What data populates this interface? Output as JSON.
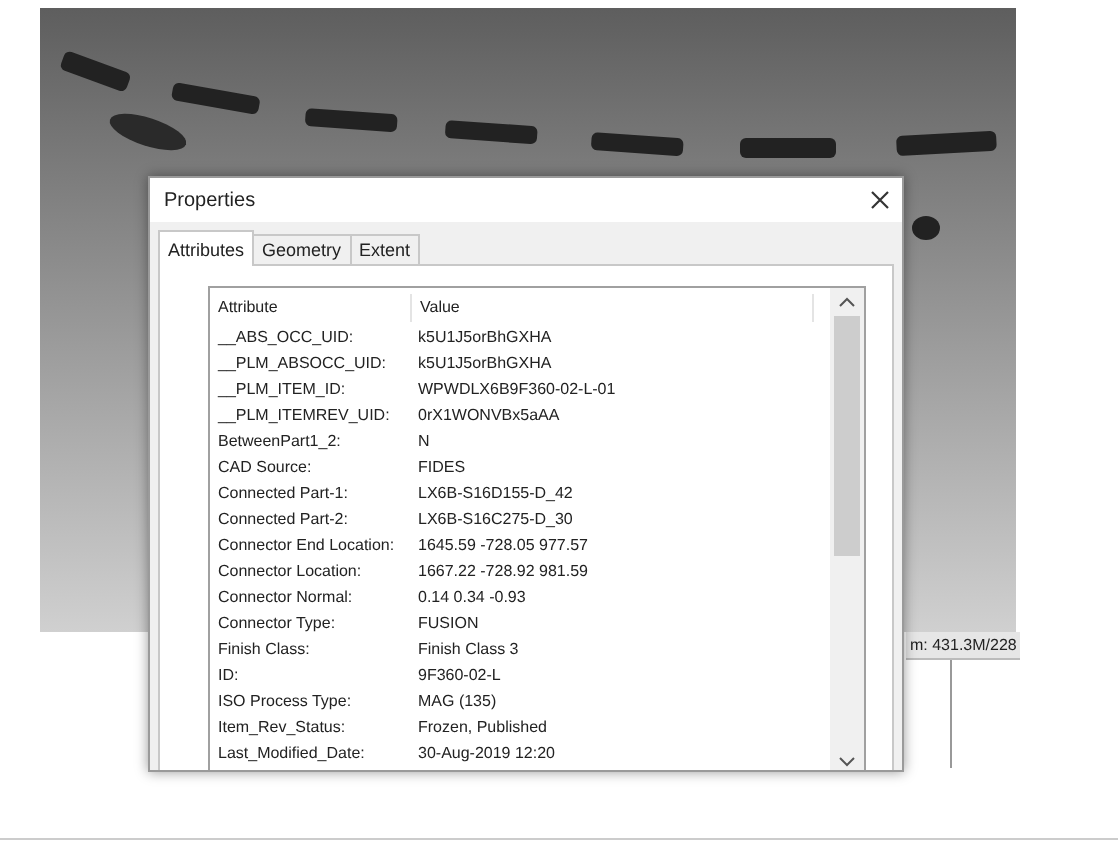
{
  "viewport": {
    "kind": "picture",
    "status_text": "m: 431.3M/228"
  },
  "dialog": {
    "title": "Properties",
    "tabs": [
      {
        "label": "Attributes",
        "selected": true
      },
      {
        "label": "Geometry",
        "selected": false
      },
      {
        "label": "Extent",
        "selected": false
      }
    ],
    "table": {
      "columns": [
        "Attribute",
        "Value"
      ],
      "rows": [
        {
          "attribute": "__ABS_OCC_UID:",
          "value": "k5U1J5orBhGXHA"
        },
        {
          "attribute": "__PLM_ABSOCC_UID:",
          "value": "k5U1J5orBhGXHA"
        },
        {
          "attribute": "__PLM_ITEM_ID:",
          "value": "WPWDLX6B9F360-02-L-01"
        },
        {
          "attribute": "__PLM_ITEMREV_UID:",
          "value": "0rX1WONVBx5aAA"
        },
        {
          "attribute": "BetweenPart1_2:",
          "value": "N"
        },
        {
          "attribute": "CAD Source:",
          "value": "FIDES"
        },
        {
          "attribute": "Connected Part-1:",
          "value": "LX6B-S16D155-D_42"
        },
        {
          "attribute": "Connected Part-2:",
          "value": "LX6B-S16C275-D_30"
        },
        {
          "attribute": "Connector End Location:",
          "value": "1645.59 -728.05 977.57"
        },
        {
          "attribute": "Connector Location:",
          "value": "1667.22 -728.92 981.59"
        },
        {
          "attribute": "Connector Normal:",
          "value": "0.14 0.34 -0.93"
        },
        {
          "attribute": "Connector Type:",
          "value": "FUSION"
        },
        {
          "attribute": "Finish Class:",
          "value": "Finish Class 3"
        },
        {
          "attribute": "ID:",
          "value": "9F360-02-L"
        },
        {
          "attribute": "ISO Process Type:",
          "value": "MAG (135)"
        },
        {
          "attribute": "Item_Rev_Status:",
          "value": "Frozen, Published"
        },
        {
          "attribute": "Last_Modified_Date:",
          "value": "30-Aug-2019 12:20"
        }
      ]
    }
  }
}
